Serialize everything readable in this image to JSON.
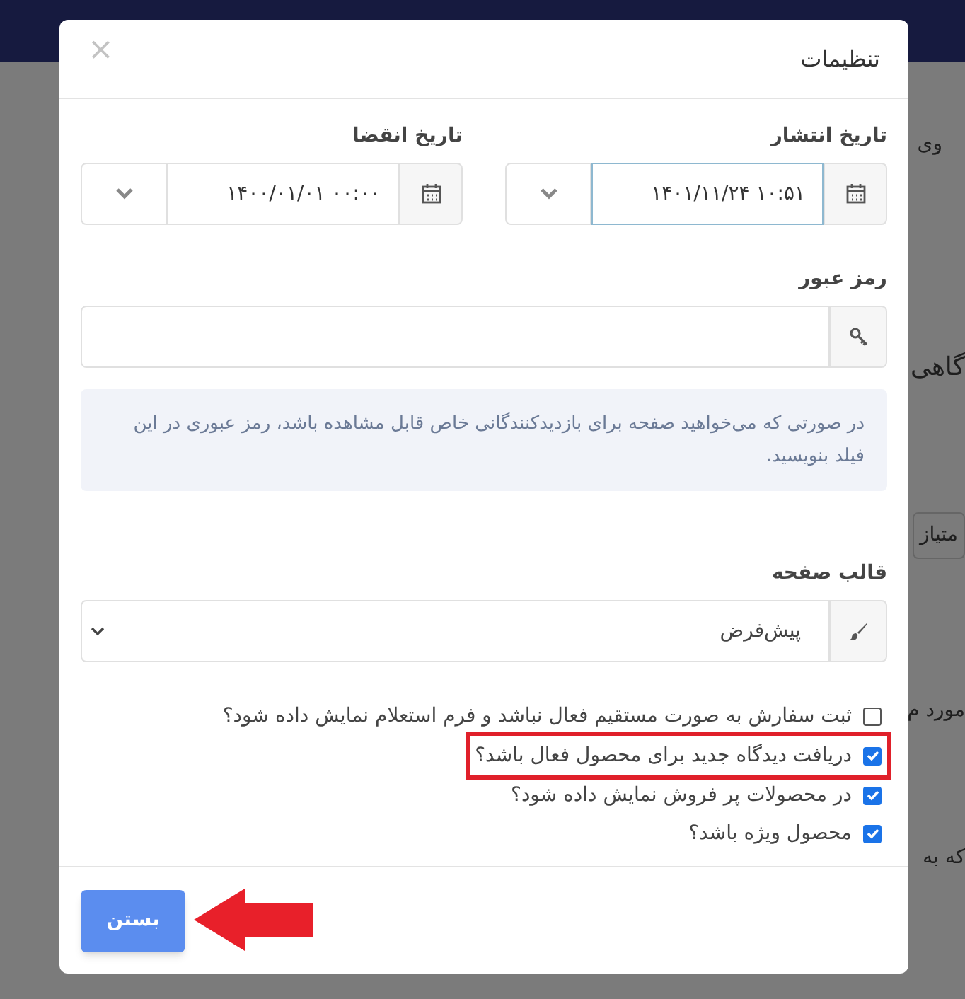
{
  "background": {
    "fragments": [
      {
        "text": "وی"
      },
      {
        "text": "گاهی"
      },
      {
        "text": "متیاز"
      },
      {
        "text": "مورد م"
      },
      {
        "text": "که به"
      }
    ]
  },
  "dialog": {
    "title": "تنظیمات",
    "close": "×",
    "dates": [
      {
        "label": "تاریخ انتشار",
        "value": "۱۴۰۱/۱۱/۲۴ ۱۰:۵۱",
        "focused": true
      },
      {
        "label": "تاریخ انقضا",
        "value": "۱۴۰۰/۰۱/۰۱ ۰۰:۰۰",
        "focused": false
      }
    ],
    "password": {
      "label": "رمز عبور",
      "help": "در صورتی که می‌خواهید صفحه برای بازدیدکنندگانی خاص قابل مشاهده باشد، رمز عبوری در این فیلد بنویسید."
    },
    "template": {
      "label": "قالب صفحه",
      "value": "پیش‌فرض"
    },
    "checkboxes": [
      {
        "label": "ثبت سفارش به صورت مستقیم فعال نباشد و فرم استعلام نمایش داده شود؟",
        "checked": false,
        "highlighted": false
      },
      {
        "label": "دریافت دیدگاه جدید برای محصول فعال باشد؟",
        "checked": true,
        "highlighted": true
      },
      {
        "label": "در محصولات پر فروش نمایش داده شود؟",
        "checked": true,
        "highlighted": false
      },
      {
        "label": "محصول ویژه باشد؟",
        "checked": true,
        "highlighted": false
      }
    ],
    "close_button": {
      "label": "بستن",
      "pointed_by_arrow": true
    }
  }
}
